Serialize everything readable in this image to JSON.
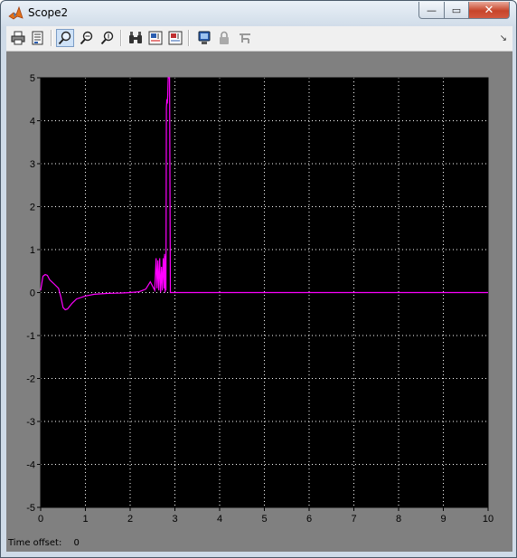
{
  "window": {
    "title": "Scope2",
    "min_label": "—",
    "max_label": "▭",
    "close_label": "✕"
  },
  "toolbar": {
    "buttons": [
      {
        "name": "print-icon"
      },
      {
        "name": "parameters-icon"
      },
      {
        "name": "zoom-icon",
        "pressed": true
      },
      {
        "name": "zoom-x-icon"
      },
      {
        "name": "zoom-y-icon"
      },
      {
        "name": "autoscale-icon"
      },
      {
        "name": "save-axes-icon"
      },
      {
        "name": "restore-axes-icon"
      },
      {
        "name": "floating-scope-icon"
      },
      {
        "name": "lock-axes-icon"
      },
      {
        "name": "signal-selection-icon"
      }
    ],
    "dock_label": "↘"
  },
  "footer": {
    "time_offset_label": "Time offset:",
    "time_offset_value": "0"
  },
  "colors": {
    "plot_bg": "#000000",
    "figure_bg": "#808080",
    "grid": "#ffffff",
    "trace": "#ff00ff",
    "axis_text": "#000000"
  },
  "chart_data": {
    "type": "line",
    "xlim": [
      0,
      10
    ],
    "ylim": [
      -5,
      5
    ],
    "x_ticks": [
      "0",
      "1",
      "2",
      "3",
      "4",
      "5",
      "6",
      "7",
      "8",
      "9",
      "10"
    ],
    "y_ticks": [
      "5",
      "4",
      "3",
      "2",
      "1",
      "0",
      "-1",
      "-2",
      "-3",
      "-4",
      "-5"
    ],
    "grid": true,
    "series": [
      {
        "color": "#ff00ff",
        "x": [
          0,
          0.05,
          0.1,
          0.15,
          0.2,
          0.3,
          0.4,
          0.45,
          0.5,
          0.55,
          0.6,
          0.7,
          0.8,
          1.0,
          1.2,
          1.5,
          1.8,
          2.0,
          2.2,
          2.35,
          2.45,
          2.5,
          2.55,
          2.58,
          2.6,
          2.62,
          2.64,
          2.66,
          2.68,
          2.7,
          2.72,
          2.74,
          2.76,
          2.77,
          2.78,
          2.79,
          2.8,
          2.81,
          2.82,
          2.83,
          2.84,
          2.845,
          2.85,
          2.86,
          2.87,
          2.88,
          2.9,
          3.0,
          4.0,
          5.0,
          6.0,
          7.0,
          8.0,
          9.0,
          10.0
        ],
        "y": [
          0.05,
          0.38,
          0.42,
          0.4,
          0.3,
          0.2,
          0.1,
          -0.1,
          -0.35,
          -0.4,
          -0.38,
          -0.25,
          -0.15,
          -0.08,
          -0.04,
          -0.02,
          -0.01,
          0.0,
          0.02,
          0.08,
          0.25,
          0.15,
          0.05,
          0.8,
          0.1,
          0.75,
          0.05,
          0.8,
          0.0,
          0.6,
          0.05,
          0.8,
          0.1,
          0.9,
          0.0,
          0.85,
          0.05,
          4.3,
          4.5,
          4.4,
          4.6,
          4.8,
          5.0,
          5.0,
          5.0,
          5.0,
          0.0,
          0.0,
          0.0,
          0.0,
          0.0,
          0.0,
          0.0,
          0.0,
          0.0
        ]
      }
    ]
  }
}
